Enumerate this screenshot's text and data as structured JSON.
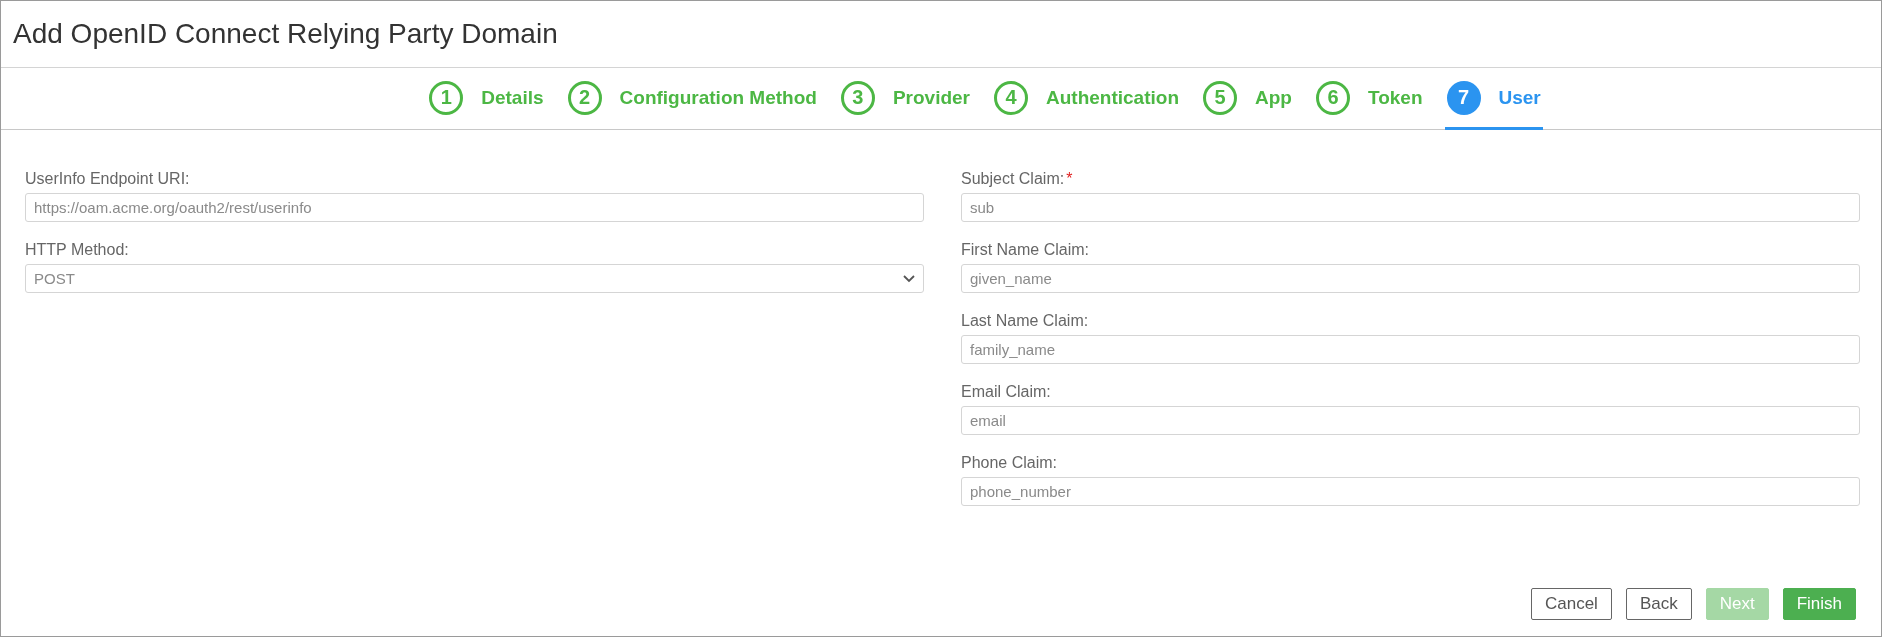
{
  "title": "Add OpenID Connect Relying Party Domain",
  "steps": [
    {
      "number": "1",
      "label": "Details",
      "selected": false
    },
    {
      "number": "2",
      "label": "Configuration Method",
      "selected": false
    },
    {
      "number": "3",
      "label": "Provider",
      "selected": false
    },
    {
      "number": "4",
      "label": "Authentication",
      "selected": false
    },
    {
      "number": "5",
      "label": "App",
      "selected": false
    },
    {
      "number": "6",
      "label": "Token",
      "selected": false
    },
    {
      "number": "7",
      "label": "User",
      "selected": true
    }
  ],
  "left_fields": [
    {
      "kind": "text",
      "label": "UserInfo Endpoint URI:",
      "value": "https://oam.acme.org/oauth2/rest/userinfo"
    },
    {
      "kind": "select",
      "label": "HTTP Method:",
      "value": "POST"
    }
  ],
  "right_fields": [
    {
      "kind": "text",
      "label": "Subject Claim:",
      "value": "sub",
      "required_mark": "*"
    },
    {
      "kind": "text",
      "label": "First Name Claim:",
      "value": "given_name"
    },
    {
      "kind": "text",
      "label": "Last Name Claim:",
      "value": "family_name"
    },
    {
      "kind": "text",
      "label": "Email Claim:",
      "value": "email"
    },
    {
      "kind": "text",
      "label": "Phone Claim:",
      "value": "phone_number"
    }
  ],
  "buttons": [
    {
      "kind": "outline",
      "label": "Cancel",
      "disabled": false
    },
    {
      "kind": "outline",
      "label": "Back",
      "disabled": false
    },
    {
      "kind": "primary",
      "label": "Next",
      "disabled": true
    },
    {
      "kind": "primary",
      "label": "Finish",
      "disabled": false
    }
  ]
}
